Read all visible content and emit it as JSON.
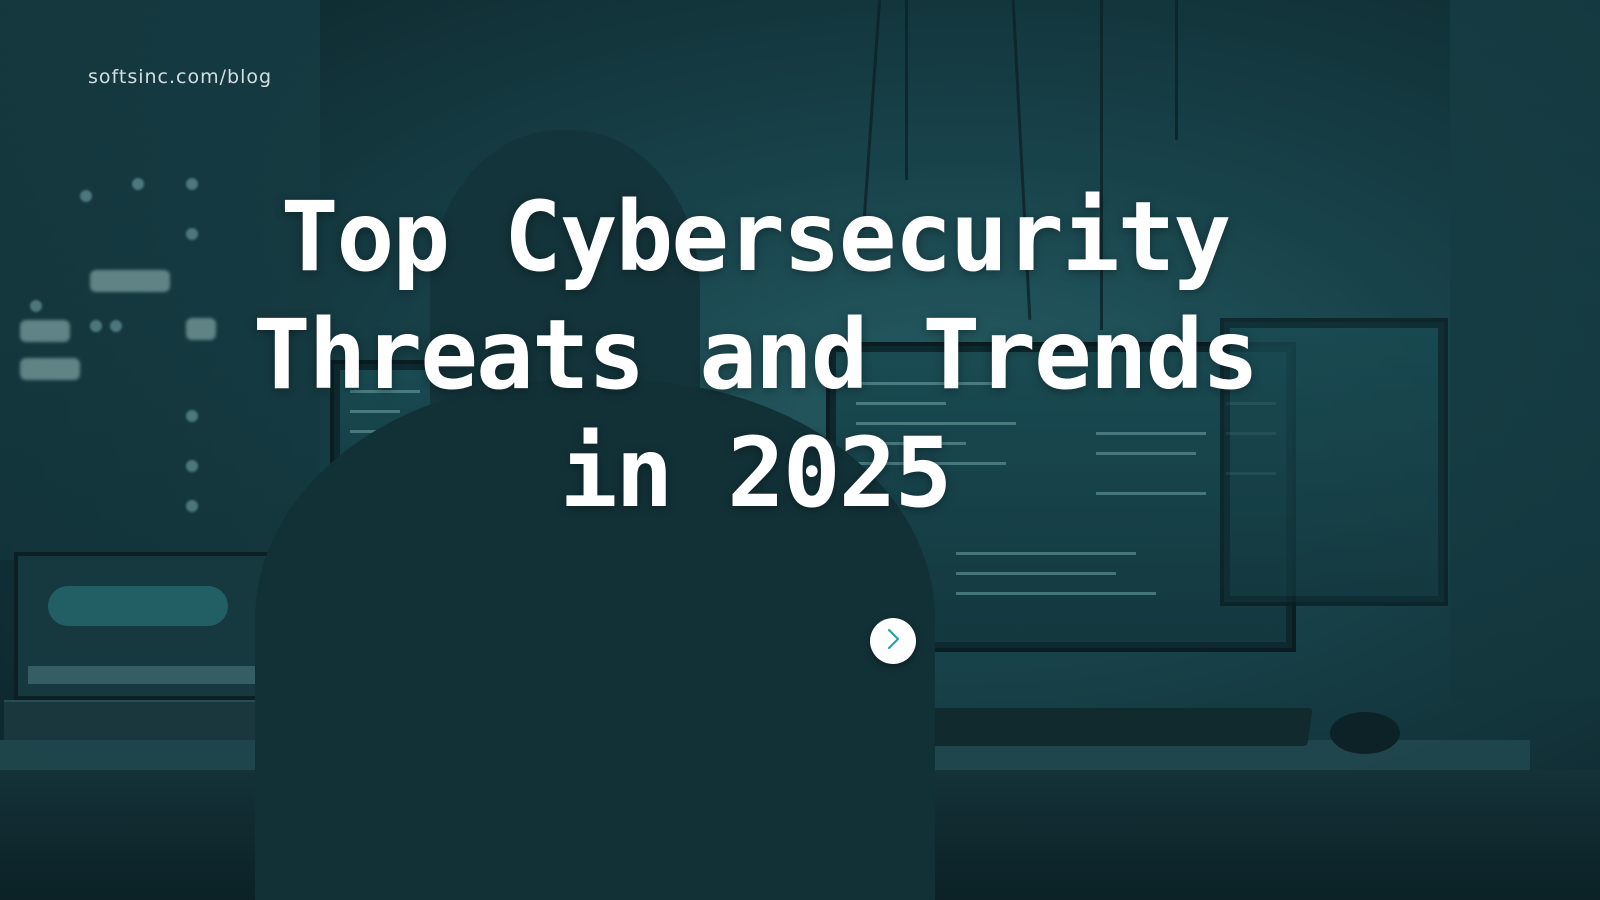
{
  "site": {
    "url": "softsinc.com/blog"
  },
  "hero": {
    "title": "Top Cybersecurity Threats and Trends in 2025"
  },
  "controls": {
    "next_icon": "chevron-right-icon"
  },
  "colors": {
    "accent": "#2a9fb0",
    "text": "#ffffff",
    "background": "#1d4d56"
  }
}
